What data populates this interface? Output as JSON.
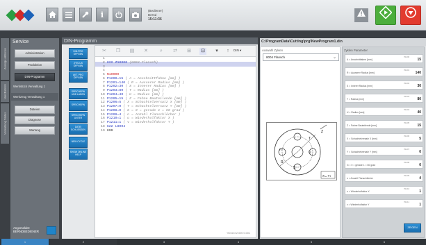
{
  "header": {
    "user_role": "(Bediener)",
    "user_name": "Bernd",
    "time": "15:11:36",
    "icons": [
      "home-icon",
      "list-icon",
      "wrench-icon",
      "info-icon",
      "power-icon",
      "camera-icon"
    ],
    "warning_icon": "triangle-warning-icon",
    "start_button_color": "#4cae3c",
    "stop_button_color": "#e23b2e"
  },
  "side_tabs": [
    "Anzeige Aktionen",
    "Handbetrieb",
    "Verwaltung Status"
  ],
  "sidebar": {
    "title": "Service",
    "items": [
      {
        "label": "Administration"
      },
      {
        "label": "Produktion"
      },
      {
        "label": "DIN-Programm"
      }
    ],
    "flat_items": [
      {
        "label": "Werkstück Verwaltung 1"
      },
      {
        "label": "Werkzeug Verwaltung 1"
      }
    ],
    "lower_items": [
      {
        "label": "Dateien"
      },
      {
        "label": "Diagnose"
      },
      {
        "label": "Wartung"
      }
    ],
    "user_label_1": "Angemeldet:",
    "user_label_2": "BERNDBEDIENER"
  },
  "main": {
    "title": "DIN-Programm",
    "buttons": [
      {
        "label": "DIN-PRG ÖFFNEN"
      },
      {
        "label": "ZYKLUS ÖFFNEN"
      },
      {
        "label": "AKT. PRG ÖFFNEN"
      },
      {
        "label": "SPEICHERN UND LADEN"
      },
      {
        "label": "SPEICHERN"
      },
      {
        "label": "SPEICHERN UNTER"
      },
      {
        "label": "DATEI SCHLIESSEN"
      },
      {
        "label": "NEW CYCLE"
      },
      {
        "label": "SHOW ONLINE HELP"
      }
    ],
    "toolbar_din_label": "DIN",
    "status_text": "%0.text  2.000  0.001",
    "code_lines": [
      {
        "n": "1",
        "parts": []
      },
      {
        "n": "2",
        "parts": [
          {
            "t": "G22 ",
            "c": "bl"
          },
          {
            "t": "Z10000 ",
            "c": "bl"
          },
          {
            "t": "(8004.Flansch)",
            "c": "cm"
          }
        ]
      },
      {
        "n": "3",
        "parts": []
      },
      {
        "n": "4",
        "parts": []
      },
      {
        "n": "5",
        "parts": [
          {
            "t": "N10000",
            "c": "rd"
          }
        ]
      },
      {
        "n": "6",
        "parts": [
          {
            "t": "P1200=15 ",
            "c": "bl"
          },
          {
            "t": "( A = Anschnittfahne [mm] )",
            "c": "cm"
          }
        ]
      },
      {
        "n": "7",
        "parts": [
          {
            "t": "P1201=140 ",
            "c": "bl"
          },
          {
            "t": "( R = Ausserer Radius [mm] )",
            "c": "cm"
          }
        ]
      },
      {
        "n": "8",
        "parts": [
          {
            "t": "P1202=30 ",
            "c": "bl"
          },
          {
            "t": "( S = Innerer Radius [mm] )",
            "c": "cm"
          }
        ]
      },
      {
        "n": "9",
        "parts": [
          {
            "t": "P1203=80 ",
            "c": "bl"
          },
          {
            "t": "( T = Radius [mm] )",
            "c": "cm"
          }
        ]
      },
      {
        "n": "10",
        "parts": [
          {
            "t": "P1204=40 ",
            "c": "bl"
          },
          {
            "t": "( U = Radius [mm] )",
            "c": "cm"
          }
        ]
      },
      {
        "n": "11",
        "parts": [
          {
            "t": "P1205=15 ",
            "c": "bl"
          },
          {
            "t": "( Z = Fahne Bauteilende [mm] )",
            "c": "cm"
          }
        ]
      },
      {
        "n": "12",
        "parts": [
          {
            "t": "P1206=5 ",
            "c": "bl"
          },
          {
            "t": "( X = Schachtelversatz X [mm] )",
            "c": "cm"
          }
        ]
      },
      {
        "n": "13",
        "parts": [
          {
            "t": "P1207=0 ",
            "c": "bl"
          },
          {
            "t": "( Y = Schachtelversatz Y [mm] )",
            "c": "cm"
          }
        ]
      },
      {
        "n": "14",
        "parts": [
          {
            "t": "P1208=0 ",
            "c": "bl"
          },
          {
            "t": "( G = 0 = gerade 1 = 60 grad )",
            "c": "cm"
          }
        ]
      },
      {
        "n": "15",
        "parts": [
          {
            "t": "P1209=4 ",
            "c": "bl"
          },
          {
            "t": "( n = Anzahl Flanschlöcher )",
            "c": "cm"
          }
        ]
      },
      {
        "n": "16",
        "parts": [
          {
            "t": "P1210=1 ",
            "c": "bl"
          },
          {
            "t": "( u = Wiederholfaktor X )",
            "c": "cm"
          }
        ]
      },
      {
        "n": "17",
        "parts": [
          {
            "t": "P1211=1 ",
            "c": "bl"
          },
          {
            "t": "( v = Wiederholfaktor Y )",
            "c": "cm"
          }
        ]
      },
      {
        "n": "18",
        "parts": [
          {
            "t": "G22 ",
            "c": "bl"
          },
          {
            "t": "L8004",
            "c": "bl"
          }
        ]
      },
      {
        "n": "19",
        "parts": [
          {
            "t": "G99",
            "c": "nb"
          }
        ]
      }
    ]
  },
  "right": {
    "path": "C:\\ProgramData\\Cutting\\prg\\NewProgram1.din",
    "select_label": "Auswahl Zyklen",
    "select_value": "8004 Flansch",
    "params_label": "Zyklen Parameter",
    "params": [
      {
        "label": "A = Anschnittfahne [mm]",
        "unit": "P1200",
        "value": "15"
      },
      {
        "label": "R = Ausserer Radius [mm]",
        "unit": "P1201",
        "value": "140"
      },
      {
        "label": "S = Innerer Radius [mm]",
        "unit": "P1202",
        "value": "30"
      },
      {
        "label": "T = Radius [mm]",
        "unit": "P1203",
        "value": "80"
      },
      {
        "label": "U = Radius [mm]",
        "unit": "P1204",
        "value": "40"
      },
      {
        "label": "Z = Fahne Bauteilende [mm]",
        "unit": "P1205",
        "value": "15"
      },
      {
        "label": "X = Schachtelversatz X [mm]",
        "unit": "P1206",
        "value": "5"
      },
      {
        "label": "Y = Schachtelversatz Y [mm]",
        "unit": "P1207",
        "value": "0"
      },
      {
        "label": "G = 0 = gerade 1 = 60 grad",
        "unit": "P1208",
        "value": "0"
      },
      {
        "label": "n = Anzahl Flanschlöcher",
        "unit": "P1209",
        "value": "4"
      },
      {
        "label": "u = Wiederholfaktor X",
        "unit": "P1210",
        "value": "1"
      },
      {
        "label": "v = Wiederholfaktor Y",
        "unit": "P1211",
        "value": "1"
      }
    ],
    "accept_label": "ZEIGEN"
  },
  "bottom_tabs": [
    "1",
    "2",
    "3",
    "4",
    "5",
    "6"
  ]
}
